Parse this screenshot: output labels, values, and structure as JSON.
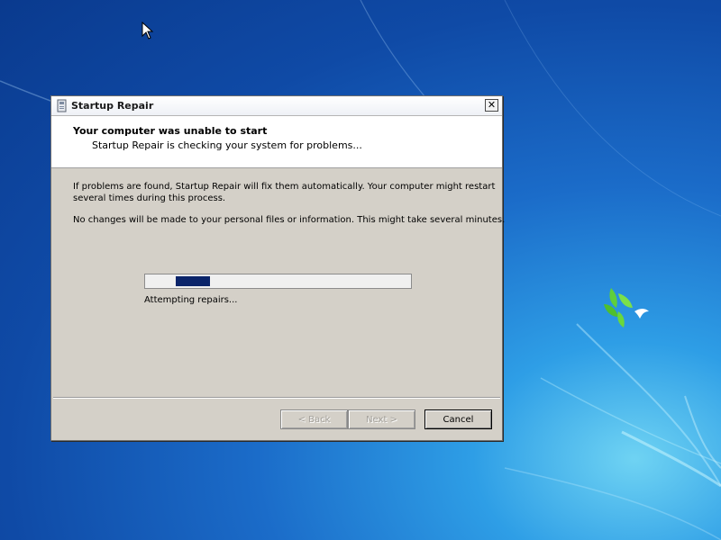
{
  "window": {
    "title": "Startup Repair",
    "close_label": "✕"
  },
  "header": {
    "title": "Your computer was unable to start",
    "subtitle": "Startup Repair is checking your system for problems..."
  },
  "body": {
    "paragraph1": "If problems are found, Startup Repair will fix them automatically. Your computer might restart several times during this process.",
    "paragraph2": "No changes will be made to your personal files or information. This might take several minutes."
  },
  "progress": {
    "status": "Attempting repairs...",
    "indeterminate": true,
    "segment_start_fraction": 0.115,
    "segment_fraction": 0.13
  },
  "buttons": {
    "back_label": "< Back",
    "next_label": "Next >",
    "cancel_label": "Cancel"
  },
  "icons": {
    "title_icon": "startup-repair-icon",
    "cursor": "arrow-cursor-icon"
  },
  "colors": {
    "progress_fill": "#0a246a",
    "dialog_bg": "#d4d0c8",
    "header_bg": "#ffffff"
  }
}
